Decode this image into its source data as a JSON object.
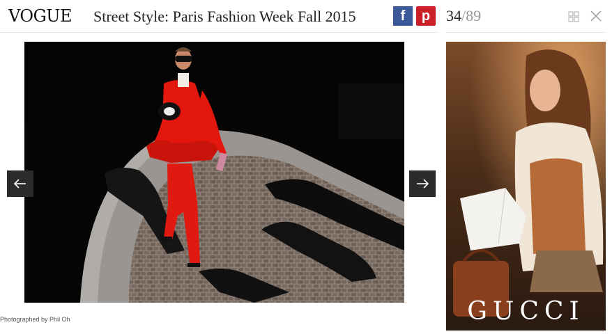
{
  "header": {
    "logo": "VOGUE",
    "title": "Street Style: Paris Fashion Week Fall 2015",
    "share": {
      "facebook_glyph": "f",
      "facebook_color": "#3b5998",
      "pinterest_glyph": "p",
      "pinterest_color": "#cb2027"
    },
    "counter": {
      "current": "34",
      "separator": "/",
      "total": "89"
    },
    "icons": {
      "grid": "grid-icon",
      "close": "close-icon"
    }
  },
  "gallery": {
    "photo_alt": "Woman in red suit walking on cobblestone street",
    "credit": "Photographed by Phil Oh",
    "prev_icon": "arrow-left-icon",
    "next_icon": "arrow-right-icon"
  },
  "ad": {
    "brand": "GUCCI"
  },
  "colors": {
    "accent_dark": "#2b2b2b",
    "suit_red": "#e01a10"
  }
}
